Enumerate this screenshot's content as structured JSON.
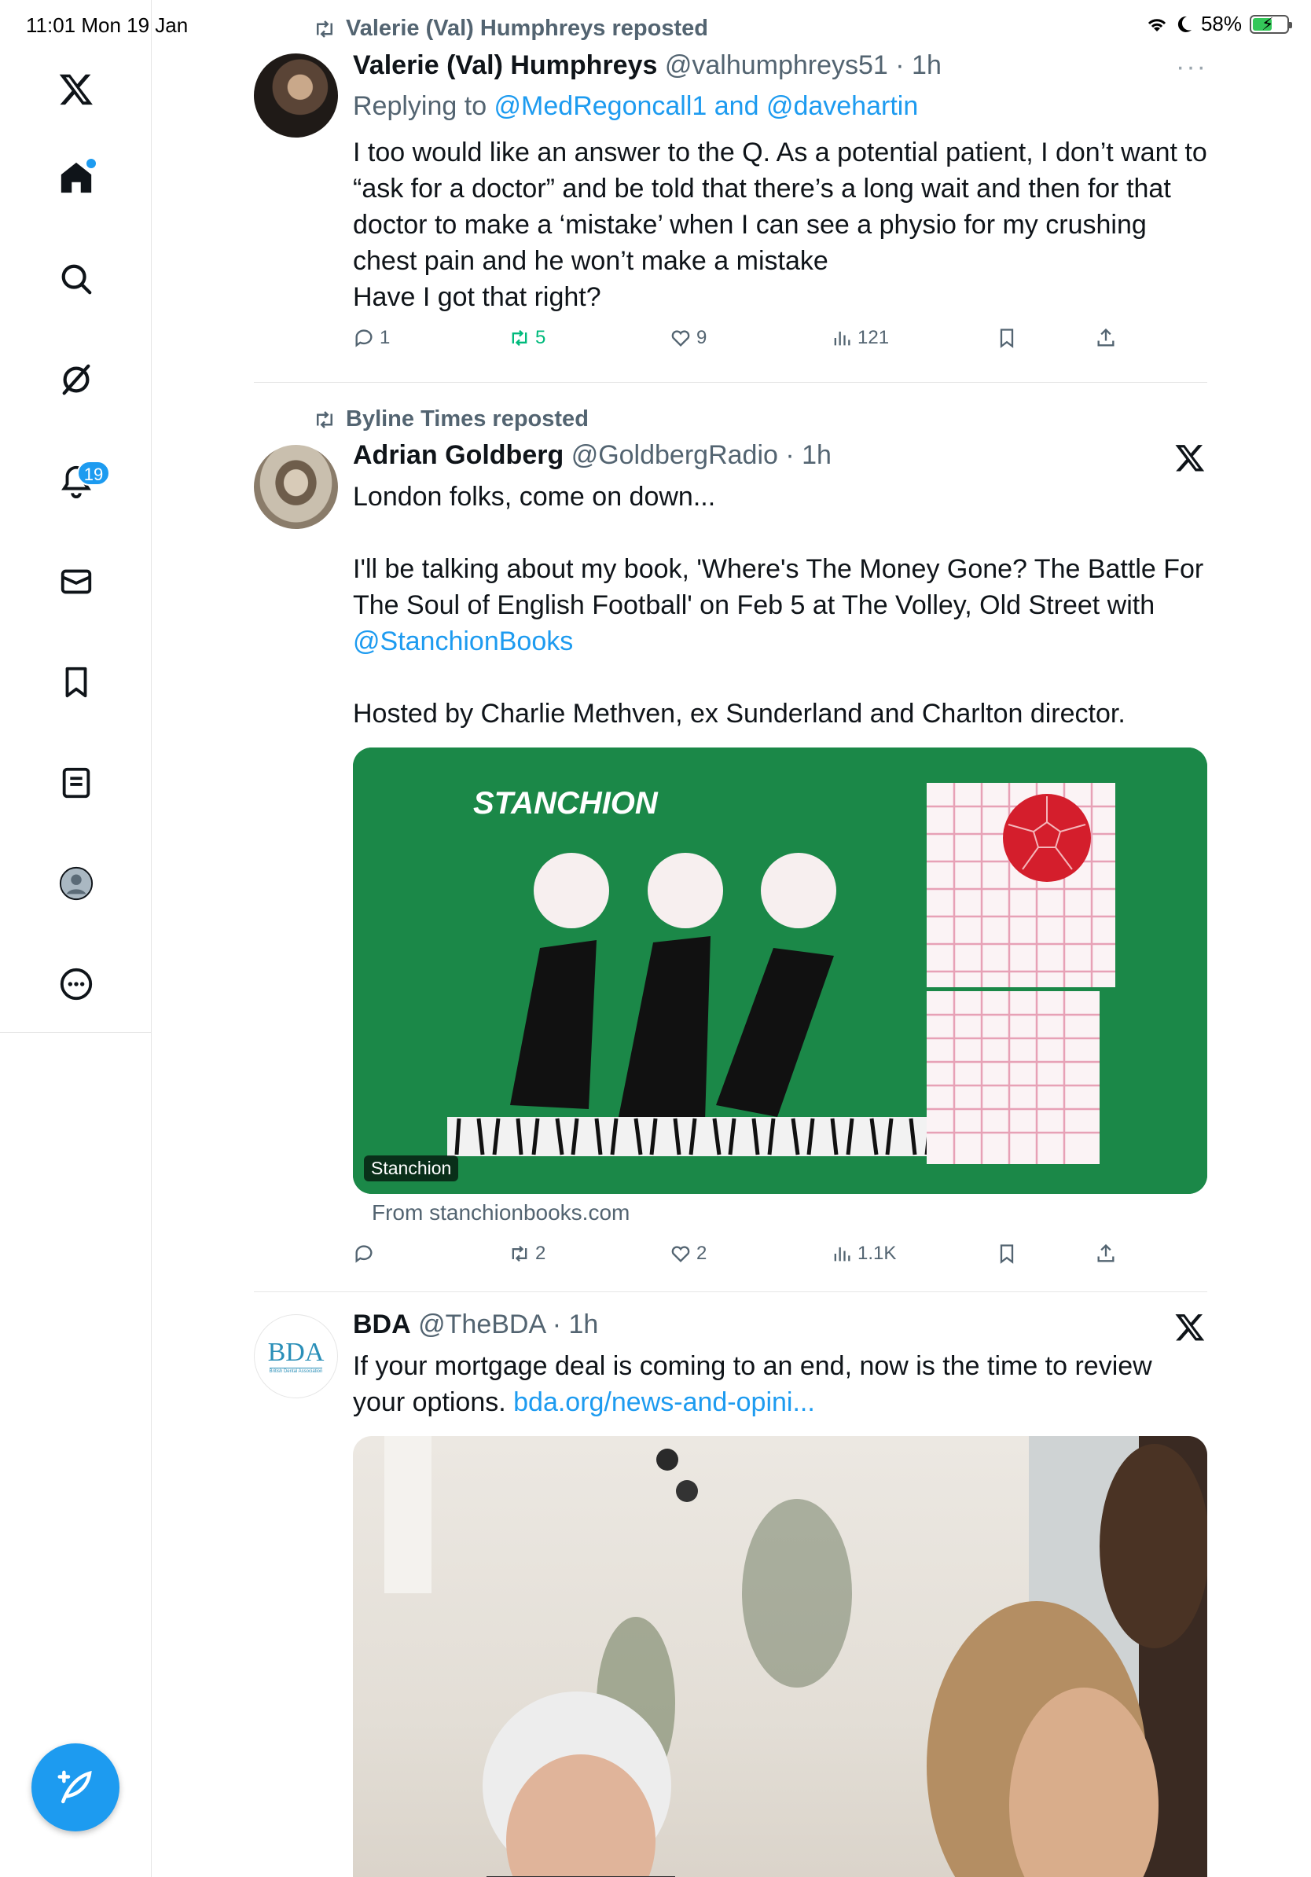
{
  "status_bar": {
    "time_date": "11:01  Mon 19 Jan",
    "battery": "58%",
    "battery_level": 0.58
  },
  "sidebar": {
    "items": [
      {
        "name": "x-logo",
        "icon": "x-logo-icon"
      },
      {
        "name": "home",
        "icon": "home-icon"
      },
      {
        "name": "search",
        "icon": "search-icon"
      },
      {
        "name": "grok",
        "icon": "grok-icon"
      },
      {
        "name": "notifications",
        "icon": "bell-icon",
        "badge": "19"
      },
      {
        "name": "messages",
        "icon": "mail-icon"
      },
      {
        "name": "bookmarks",
        "icon": "bookmark-icon"
      },
      {
        "name": "lists",
        "icon": "list-icon"
      },
      {
        "name": "profile",
        "icon": "profile-icon"
      },
      {
        "name": "more",
        "icon": "more-circle-icon"
      }
    ],
    "compose_icon": "compose-feather-icon"
  },
  "tweets": [
    {
      "repost_by": "Valerie (Val) Humphreys reposted",
      "name": "Valerie (Val) Humphreys",
      "handle": "@valhumphreys51 · 1h",
      "more": "···",
      "reply_prefix": "Replying to ",
      "reply_to": "@MedRegoncall1 and @davehartin",
      "text": "I too would like an answer to the Q. As a potential patient, I don’t want to “ask for a doctor” and be told that there’s a long wait and then for that doctor to make a ‘mistake’ when I can see a physio for my crushing chest pain and he won’t make a mistake\nHave I got that right?",
      "replies": "1",
      "reposts": "5",
      "likes": "9",
      "views": "121"
    },
    {
      "repost_by": "Byline Times reposted",
      "name": "Adrian Goldberg",
      "handle": "@GoldbergRadio · 1h",
      "text_1": "London folks, come on down...",
      "text_2": "I'll be talking about my book, 'Where's The Money Gone?  The Battle For The Soul of English Football' on Feb 5 at The Volley, Old Street with",
      "mention": "@StanchionBooks",
      "text_3": "Hosted by Charlie Methven, ex Sunderland and Charlton director.",
      "card_brand": "STANCHION",
      "card_label": "Stanchion",
      "card_source": "From stanchionbooks.com",
      "replies": "",
      "reposts": "2",
      "likes": "2",
      "views": "1.1K"
    },
    {
      "name": "BDA",
      "handle": "@TheBDA · 1h",
      "avatar_text": "BDA",
      "avatar_subtext": "British Dental Association",
      "text": "If your mortgage deal is coming to an end, now is the time to review your options. ",
      "link": "bda.org/news-and-opini..."
    }
  ]
}
